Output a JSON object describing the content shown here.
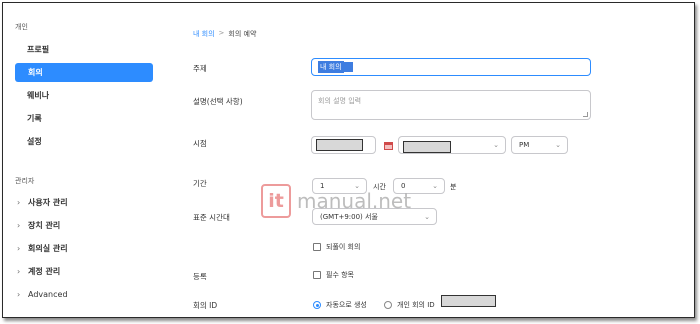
{
  "sidebar": {
    "personal_label": "개인",
    "items": [
      "프로필",
      "회의",
      "웨비나",
      "기록",
      "설정"
    ],
    "admin_label": "관리자",
    "admin_items": [
      "사용자 관리",
      "장치 관리",
      "회의실 관리",
      "계정 관리",
      "Advanced"
    ]
  },
  "breadcrumb": {
    "parent": "내 회의",
    "separator": ">",
    "current": "회의 예약"
  },
  "form": {
    "topic": {
      "label": "주제",
      "value": "내 회의"
    },
    "description": {
      "label": "설명(선택 사항)",
      "placeholder": "회의 설명 입력"
    },
    "when": {
      "label": "시점",
      "ampm": "PM"
    },
    "duration": {
      "label": "기간",
      "hours": "1",
      "hours_unit": "시간",
      "minutes": "0",
      "minutes_unit": "분"
    },
    "timezone": {
      "label": "표준 시간대",
      "value": "(GMT+9:00) 서울"
    },
    "recurring": {
      "label": "되풀이 회의"
    },
    "registration": {
      "label": "등록",
      "option": "필수 항목"
    },
    "meeting_id": {
      "label": "회의 ID",
      "auto": "자동으로 생성",
      "personal": "개인 회의 ID"
    }
  },
  "watermark": {
    "logo": "it",
    "text": "manual.net"
  },
  "colors": {
    "accent": "#2d8cff"
  }
}
